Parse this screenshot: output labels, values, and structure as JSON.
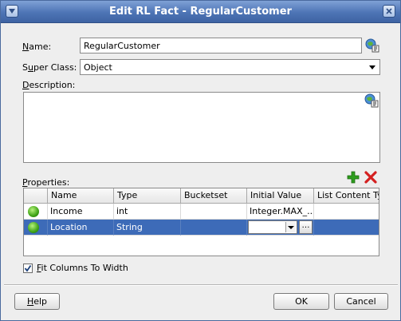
{
  "window": {
    "title": "Edit RL Fact - RegularCustomer"
  },
  "form": {
    "name_label_u": "N",
    "name_label_rest": "ame:",
    "name_value": "RegularCustomer",
    "superclass_label_pre": "S",
    "superclass_label_u": "u",
    "superclass_label_rest": "per Class:",
    "superclass_value": "Object",
    "description_label_u": "D",
    "description_label_rest": "escription:",
    "description_value": "",
    "properties_label_u": "P",
    "properties_label_rest": "roperties:"
  },
  "table": {
    "columns": [
      "Name",
      "Type",
      "Bucketset",
      "Initial Value",
      "List Content Type"
    ],
    "rows": [
      {
        "name": "Income",
        "type": "int",
        "bucketset": "",
        "initial_value": "Integer.MAX_...",
        "list_content_type": "",
        "selected": false
      },
      {
        "name": "Location",
        "type": "String",
        "bucketset": "",
        "initial_value": "",
        "list_content_type": "",
        "selected": true
      }
    ]
  },
  "options": {
    "fit_columns_label_u": "F",
    "fit_columns_label_rest": "it Columns To Width",
    "fit_columns_checked": true
  },
  "buttons": {
    "help_u": "H",
    "help_rest": "elp",
    "ok": "OK",
    "cancel": "Cancel"
  },
  "icons": {
    "add": "add-icon",
    "delete": "delete-icon",
    "translate": "resource-bundle-icon",
    "status": "valid-status-icon"
  },
  "colors": {
    "titlebar": "#4d74b5",
    "selection": "#3d6bb8",
    "add_green": "#2e9d1e",
    "delete_red": "#d42020"
  }
}
